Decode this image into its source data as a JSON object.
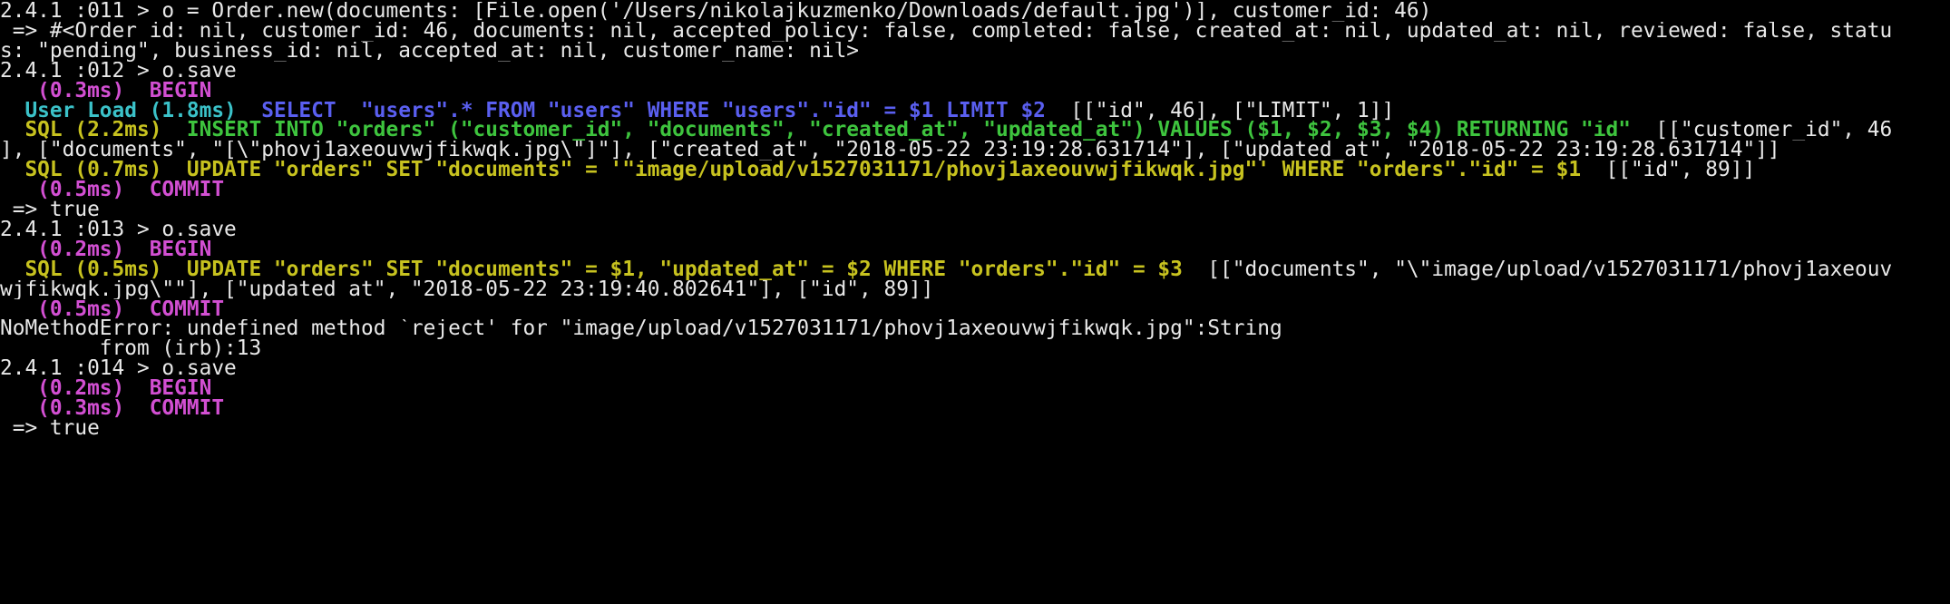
{
  "colors": {
    "background": "#000000",
    "text": "#e8e8e8",
    "magenta": "#d24fd2",
    "cyan": "#3bc2c9",
    "blue": "#5a5ff0",
    "green": "#3ec43e",
    "yellow": "#c7c21f"
  },
  "lines": [
    {
      "segs": [
        {
          "t": "2.4.1 :011 > o = Order.new(documents: [File.open('/Users/nikolajkuzmenko/Downloads/default.jpg')], customer_id: 46)"
        }
      ]
    },
    {
      "segs": [
        {
          "t": " => #<Order id: nil, customer_id: 46, documents: nil, accepted_policy: false, completed: false, created_at: nil, updated_at: nil, reviewed: false, statu"
        }
      ]
    },
    {
      "segs": [
        {
          "t": "s: \"pending\", business_id: nil, accepted_at: nil, customer_name: nil>"
        }
      ]
    },
    {
      "segs": [
        {
          "t": "2.4.1 :012 > o.save"
        }
      ]
    },
    {
      "segs": [
        {
          "t": "   (0.3ms)  BEGIN",
          "c": "mag"
        }
      ]
    },
    {
      "segs": [
        {
          "t": "  User Load (1.8ms)  ",
          "c": "cyan"
        },
        {
          "t": "SELECT  \"users\".* FROM \"users\" WHERE \"users\".\"id\" = $1 LIMIT $2",
          "c": "blue"
        },
        {
          "t": "  [[\"id\", 46], [\"LIMIT\", 1]]"
        }
      ]
    },
    {
      "segs": [
        {
          "t": "  SQL (2.2ms)  ",
          "c": "yel"
        },
        {
          "t": "INSERT INTO \"orders\" (\"customer_id\", \"documents\", \"created_at\", \"updated_at\") VALUES ($1, $2, $3, $4) RETURNING \"id\"",
          "c": "grn"
        },
        {
          "t": "  [[\"customer_id\", 46"
        }
      ]
    },
    {
      "segs": [
        {
          "t": "], [\"documents\", \"[\\\"phovj1axeouvwjfikwqk.jpg\\\"]\"], [\"created_at\", \"2018-05-22 23:19:28.631714\"], [\"updated_at\", \"2018-05-22 23:19:28.631714\"]]"
        }
      ]
    },
    {
      "segs": [
        {
          "t": "  SQL (0.7ms)  ",
          "c": "yel"
        },
        {
          "t": "UPDATE \"orders\" SET \"documents\" = '\"image/upload/v1527031171/phovj1axeouvwjfikwqk.jpg\"' WHERE \"orders\".\"id\" = $1",
          "c": "yel"
        },
        {
          "t": "  [[\"id\", 89]]"
        }
      ]
    },
    {
      "segs": [
        {
          "t": "   (0.5ms)  COMMIT",
          "c": "mag"
        }
      ]
    },
    {
      "segs": [
        {
          "t": " => true"
        }
      ]
    },
    {
      "segs": [
        {
          "t": "2.4.1 :013 > o.save"
        }
      ]
    },
    {
      "segs": [
        {
          "t": "   (0.2ms)  BEGIN",
          "c": "mag"
        }
      ]
    },
    {
      "segs": [
        {
          "t": "  SQL (0.5ms)  ",
          "c": "yel"
        },
        {
          "t": "UPDATE \"orders\" SET \"documents\" = $1, \"updated_at\" = $2 WHERE \"orders\".\"id\" = $3",
          "c": "yel"
        },
        {
          "t": "  [[\"documents\", \"\\\"image/upload/v1527031171/phovj1axeouv"
        }
      ]
    },
    {
      "segs": [
        {
          "t": "wjfikwqk.jpg\\\"\"], [\"updated_at\", \"2018-05-22 23:19:40.802641\"], [\"id\", 89]]"
        }
      ]
    },
    {
      "segs": [
        {
          "t": "   (0.5ms)  COMMIT",
          "c": "mag"
        }
      ]
    },
    {
      "segs": [
        {
          "t": "NoMethodError: undefined method `reject' for \"image/upload/v1527031171/phovj1axeouvwjfikwqk.jpg\":String"
        }
      ]
    },
    {
      "segs": [
        {
          "t": "        from (irb):13"
        }
      ]
    },
    {
      "segs": [
        {
          "t": "2.4.1 :014 > o.save"
        }
      ]
    },
    {
      "segs": [
        {
          "t": "   (0.2ms)  BEGIN",
          "c": "mag"
        }
      ]
    },
    {
      "segs": [
        {
          "t": "   (0.3ms)  COMMIT",
          "c": "mag"
        }
      ]
    },
    {
      "segs": [
        {
          "t": " => true"
        }
      ]
    }
  ]
}
